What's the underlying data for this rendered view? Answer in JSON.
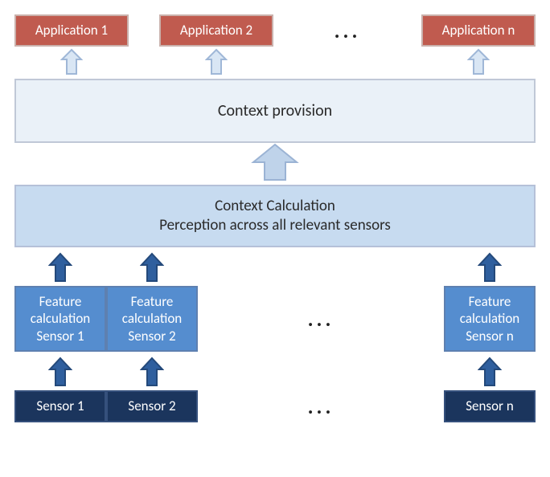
{
  "applications": {
    "items": [
      {
        "label": "Application 1"
      },
      {
        "label": "Application 2"
      },
      {
        "label": "Application n"
      }
    ],
    "ellipsis": "..."
  },
  "provision": {
    "label": "Context provision"
  },
  "context_calc": {
    "line1": "Context Calculation",
    "line2": "Perception across all relevant sensors"
  },
  "features": {
    "items": [
      {
        "l1": "Feature",
        "l2": "calculation",
        "l3": "Sensor 1"
      },
      {
        "l1": "Feature",
        "l2": "calculation",
        "l3": "Sensor 2"
      },
      {
        "l1": "Feature",
        "l2": "calculation",
        "l3": "Sensor n"
      }
    ],
    "ellipsis": "..."
  },
  "sensors": {
    "items": [
      {
        "label": "Sensor 1"
      },
      {
        "label": "Sensor 2"
      },
      {
        "label": "Sensor n"
      }
    ],
    "ellipsis": "..."
  },
  "colors": {
    "arrow_light_fill": "#d9e6f4",
    "arrow_light_stroke": "#9fb7d7",
    "arrow_mid_fill": "#bfd3ea",
    "arrow_mid_stroke": "#9bb3d4",
    "arrow_dark_fill": "#2f5f9e",
    "arrow_dark_stroke": "#24497a"
  }
}
